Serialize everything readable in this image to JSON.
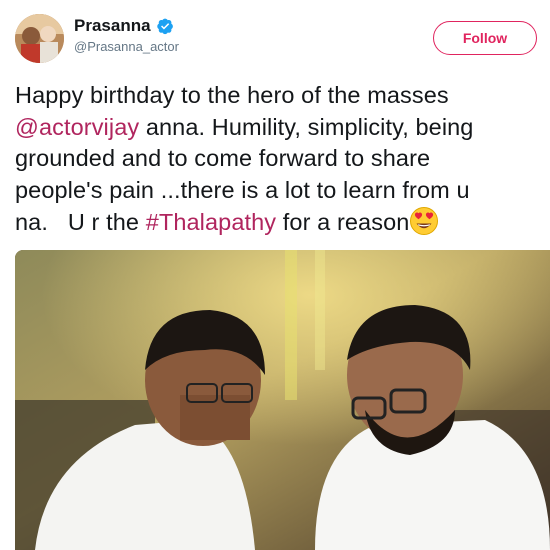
{
  "tweet": {
    "author": {
      "display_name": "Prasanna",
      "handle": "@Prasanna_actor",
      "verified": true,
      "avatar_icon": "profile-photo"
    },
    "follow_label": "Follow",
    "text": {
      "line1": "Happy birthday to the hero of the masses",
      "line2_mention": "@actorvijay",
      "line2_rest": " anna. Humility, simplicity, being",
      "line3": "grounded and to come forward to share",
      "line4": "people's pain ...there is a lot to learn from u",
      "line5_pre": "na.   U r the ",
      "line5_hashtag": "#Thalapathy",
      "line5_post": " for a reason",
      "emoji": "heart-eyes-emoji"
    },
    "media": {
      "type": "photo",
      "description_icon": "tweet-photo"
    }
  },
  "colors": {
    "link": "#b0255e",
    "follow": "#e0245e",
    "verified": "#1da1f2",
    "handle": "#657786"
  }
}
